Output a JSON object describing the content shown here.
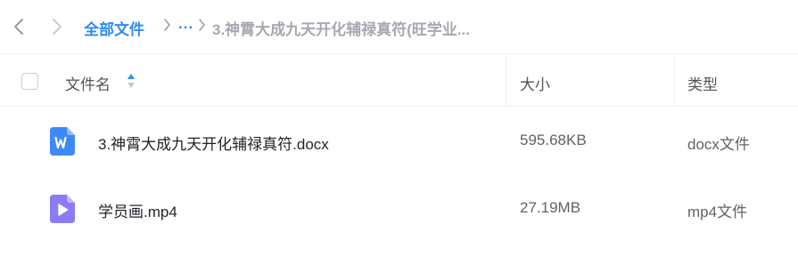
{
  "breadcrumb": {
    "root": "全部文件",
    "ellipsis": "...",
    "current": "3.神霄大成九天开化辅禄真符(旺学业..."
  },
  "header": {
    "name": "文件名",
    "size": "大小",
    "type": "类型"
  },
  "files": [
    {
      "name": "3.神霄大成九天开化辅禄真符.docx",
      "size": "595.68KB",
      "type": "docx文件",
      "icon": "word-doc-icon",
      "icon_color": "#3d8af7"
    },
    {
      "name": "学员画.mp4",
      "size": "27.19MB",
      "type": "mp4文件",
      "icon": "video-file-icon",
      "icon_color": "#8b7cf6"
    }
  ],
  "colors": {
    "accent": "#2e8cf0",
    "muted": "#a5a9b0",
    "border": "#eef0f3"
  }
}
